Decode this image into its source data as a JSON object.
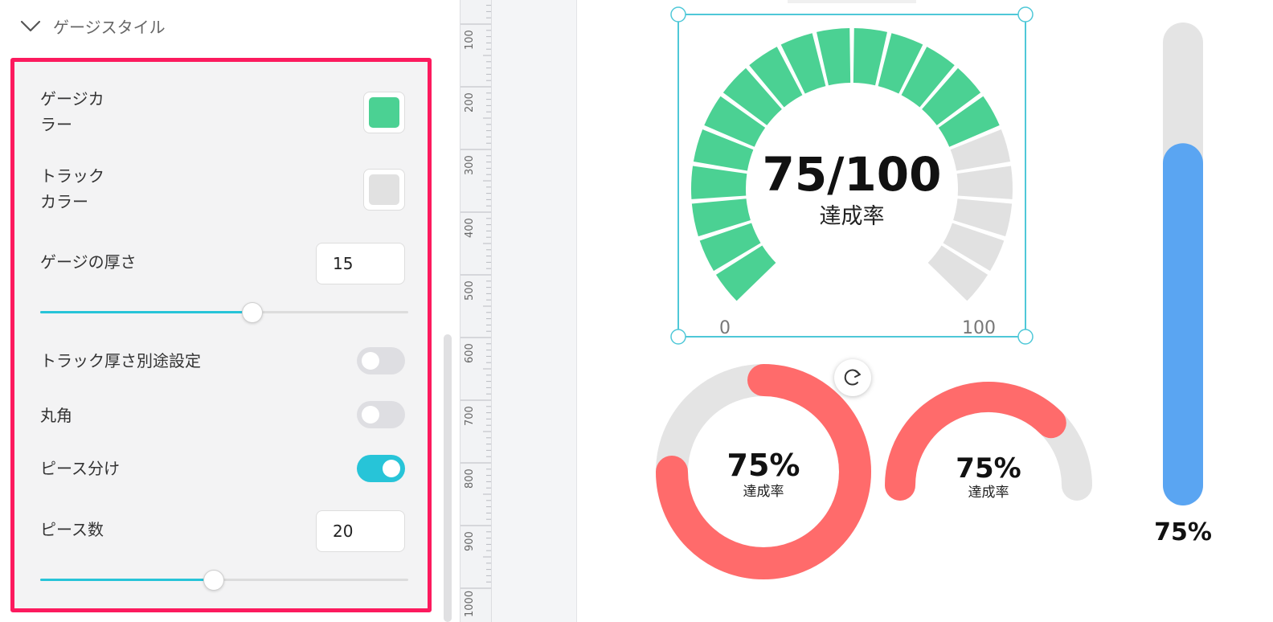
{
  "panel": {
    "section_title": "ゲージスタイル",
    "gauge_color_label_line1": "ゲージカ",
    "gauge_color_label_line2": "ラー",
    "gauge_color": "#4bd193",
    "track_color_label_line1": "トラック",
    "track_color_label_line2": "カラー",
    "track_color": "#e1e1e1",
    "thickness_label": "ゲージの厚さ",
    "thickness_value": "15",
    "thickness_slider_fraction": 0.577,
    "separate_track_label": "トラック厚さ別途設定",
    "separate_track_on": false,
    "rounded_label": "丸角",
    "rounded_on": false,
    "pieces_label": "ピース分け",
    "pieces_on": true,
    "piece_count_label": "ピース数",
    "piece_count_value": "20",
    "piece_count_slider_fraction": 0.472,
    "accent_color": "#27c4d8"
  },
  "ruler": {
    "labels": [
      "100",
      "200",
      "300",
      "400",
      "500",
      "600",
      "700",
      "800",
      "900",
      "1000"
    ]
  },
  "gauges": {
    "segmented": {
      "value_text": "75/100",
      "caption": "達成率",
      "min_label": "0",
      "max_label": "100",
      "value": 75,
      "max": 100,
      "pieces": 20,
      "fill_color": "#4bd193",
      "track_color": "#e1e1e1"
    },
    "donut": {
      "value_text": "75%",
      "caption": "達成率",
      "fraction": 0.75,
      "fill_color": "#ff6b6b",
      "track_color": "#e4e4e4"
    },
    "semi": {
      "value_text": "75%",
      "caption": "達成率",
      "fraction": 0.75,
      "fill_color": "#ff6b6b",
      "track_color": "#e4e4e4"
    },
    "bar": {
      "value_text": "75%",
      "fraction": 0.75,
      "fill_color": "#5aa5f2",
      "track_color": "#e4e4e4"
    }
  },
  "selection": {
    "color": "#4fc8d8"
  }
}
